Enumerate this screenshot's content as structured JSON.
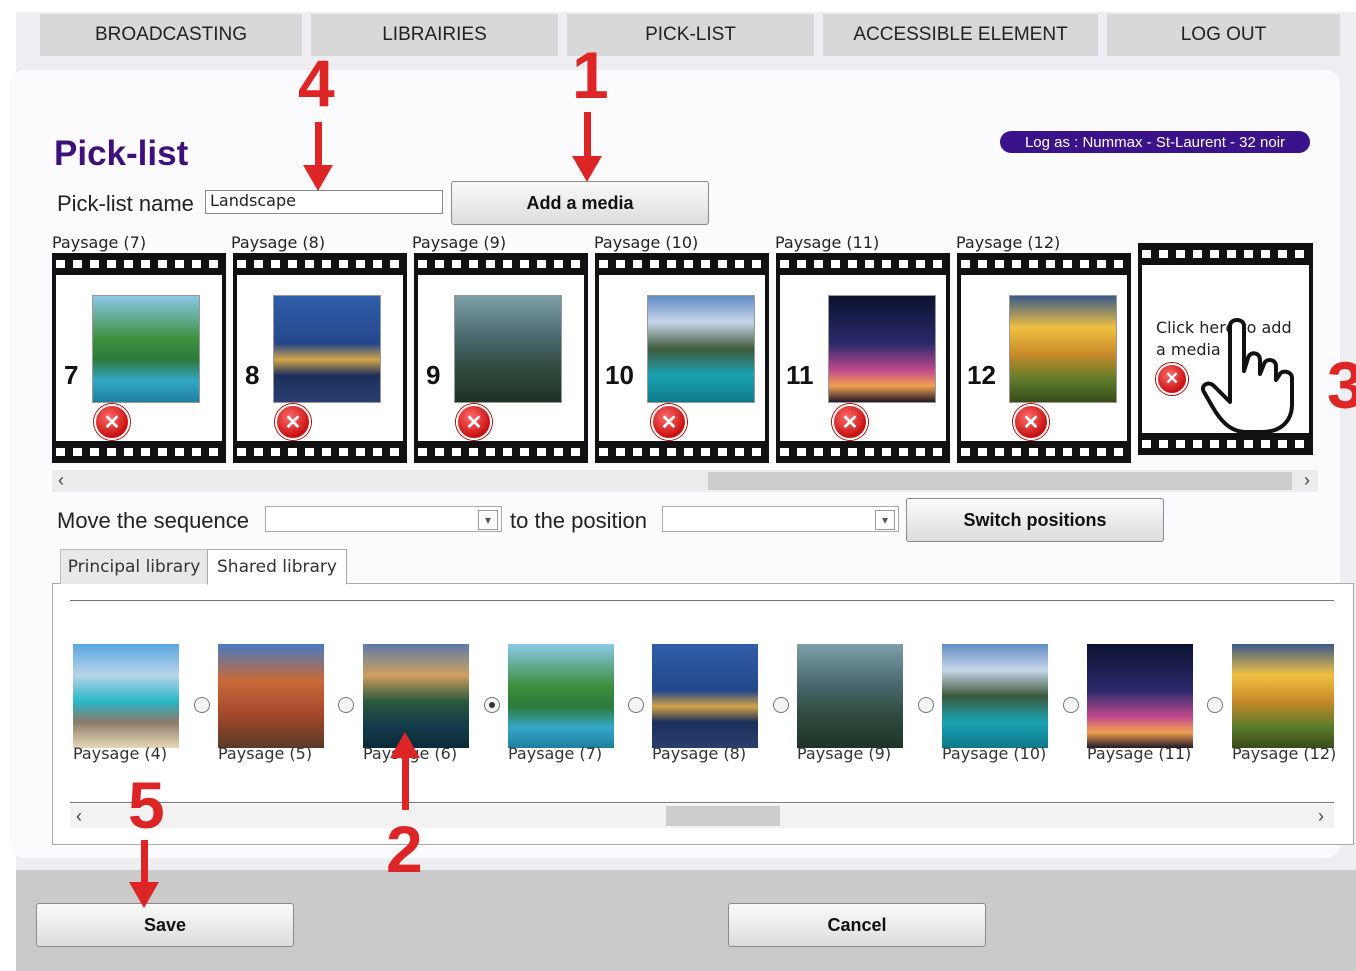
{
  "nav": [
    "BROADCASTING",
    "LIBRAIRIES",
    "PICK-LIST",
    "ACCESSIBLE ELEMENT",
    "LOG OUT"
  ],
  "page_title": "Pick-list",
  "log_as": "Log as : Nummax - St-Laurent - 32 noir",
  "picklist_name_label": "Pick-list name",
  "picklist_name_value": "Landscape",
  "add_media_label": "Add a media",
  "strip": [
    {
      "caption": "Paysage (7)",
      "number": "7"
    },
    {
      "caption": "Paysage (8)",
      "number": "8"
    },
    {
      "caption": "Paysage (9)",
      "number": "9"
    },
    {
      "caption": "Paysage (10)",
      "number": "10"
    },
    {
      "caption": "Paysage (11)",
      "number": "11"
    },
    {
      "caption": "Paysage (12)",
      "number": "12"
    }
  ],
  "add_slot_text": "Click here to add a media",
  "move_label": "Move the sequence",
  "position_label": "to the position",
  "switch_label": "Switch positions",
  "library_tabs": [
    "Principal library",
    "Shared library"
  ],
  "library": [
    {
      "caption": "Paysage (4)",
      "selected": false
    },
    {
      "caption": "Paysage (5)",
      "selected": false
    },
    {
      "caption": "Paysage (6)",
      "selected": true
    },
    {
      "caption": "Paysage (7)",
      "selected": false
    },
    {
      "caption": "Paysage (8)",
      "selected": false
    },
    {
      "caption": "Paysage (9)",
      "selected": false
    },
    {
      "caption": "Paysage (10)",
      "selected": false
    },
    {
      "caption": "Paysage (11)",
      "selected": false
    },
    {
      "caption": "Paysage (12)",
      "selected": false
    }
  ],
  "save_label": "Save",
  "cancel_label": "Cancel",
  "annotations": [
    "1",
    "2",
    "3",
    "4",
    "5"
  ],
  "colors": {
    "accent": "#3d107a",
    "badge": "#3a128a",
    "annotation": "#dd2525"
  }
}
